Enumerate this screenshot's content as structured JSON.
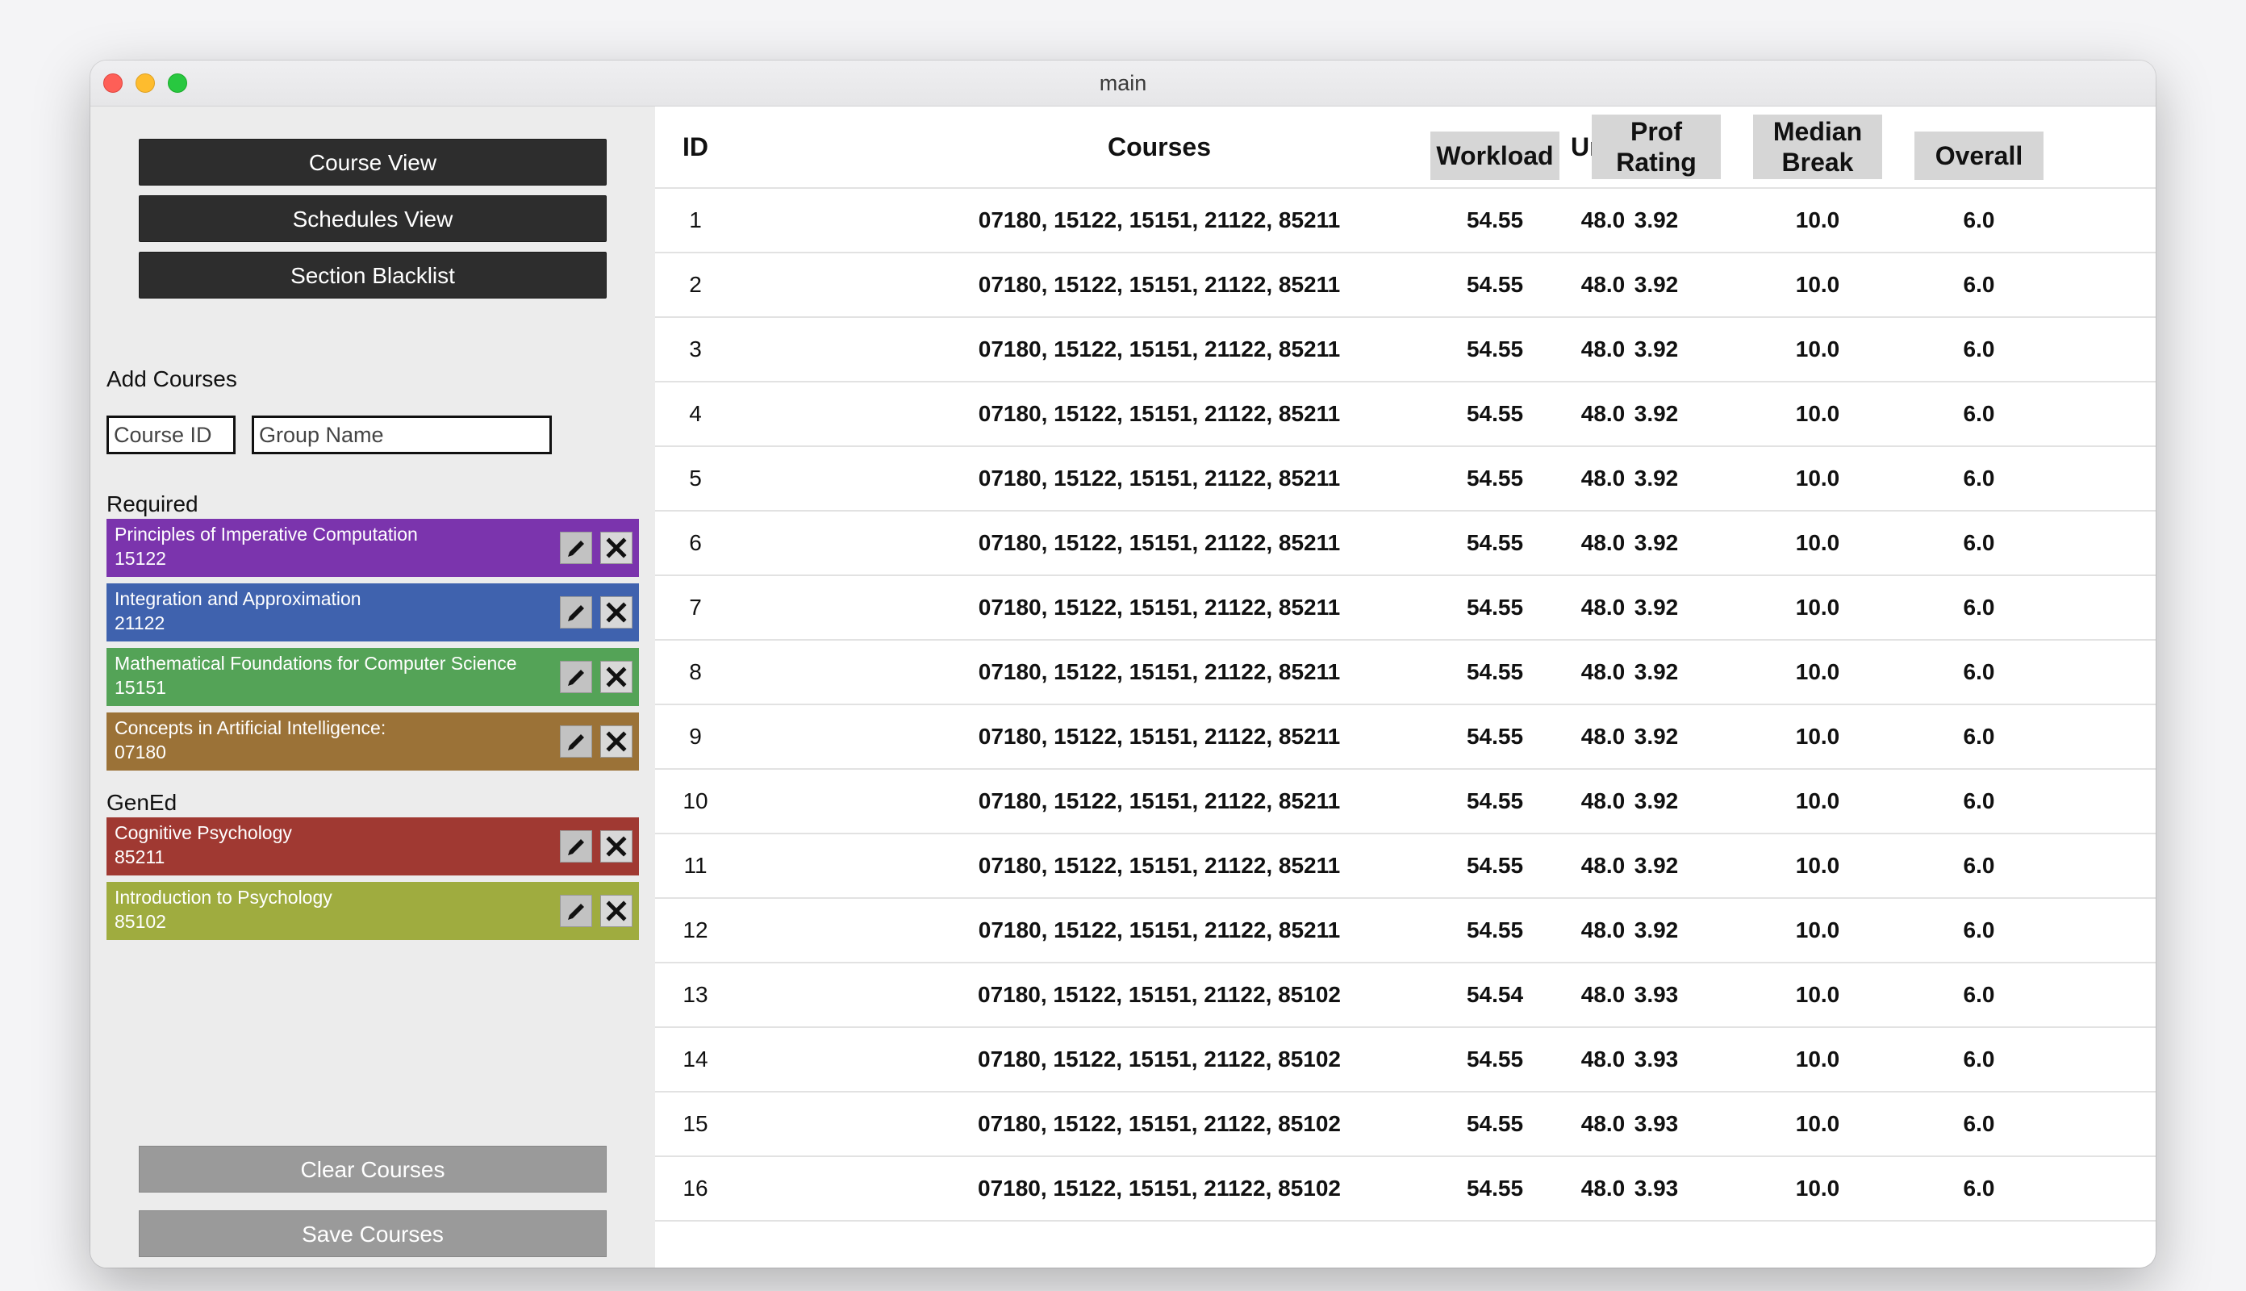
{
  "window": {
    "title": "main"
  },
  "sidebar": {
    "nav_buttons": [
      "Course View",
      "Schedules View",
      "Section Blacklist"
    ],
    "add_courses_label": "Add Courses",
    "course_id_placeholder": "Course ID",
    "group_name_placeholder": "Group Name",
    "groups": [
      {
        "name": "Required",
        "courses": [
          {
            "name": "Principles of Imperative Computation",
            "id": "15122",
            "color": "#7b34ad"
          },
          {
            "name": "Integration and Approximation",
            "id": "21122",
            "color": "#3f62ae"
          },
          {
            "name": "Mathematical Foundations for Computer Science",
            "id": "15151",
            "color": "#54a357"
          },
          {
            "name": "Concepts in Artificial Intelligence:",
            "id": "07180",
            "color": "#9b7237"
          }
        ]
      },
      {
        "name": "GenEd",
        "courses": [
          {
            "name": "Cognitive Psychology",
            "id": "85211",
            "color": "#a03932"
          },
          {
            "name": "Introduction to Psychology",
            "id": "85102",
            "color": "#9fac3f"
          }
        ]
      }
    ],
    "clear_courses_label": "Clear Courses",
    "save_courses_label": "Save Courses"
  },
  "table": {
    "headers": [
      "ID",
      "Courses",
      "Units",
      "Workload",
      "Prof Rating",
      "Median Break",
      "Overall"
    ],
    "rows": [
      [
        "1",
        "07180, 15122, 15151, 21122, 85211",
        "48.0",
        "54.55",
        "3.92",
        "10.0",
        "6.0"
      ],
      [
        "2",
        "07180, 15122, 15151, 21122, 85211",
        "48.0",
        "54.55",
        "3.92",
        "10.0",
        "6.0"
      ],
      [
        "3",
        "07180, 15122, 15151, 21122, 85211",
        "48.0",
        "54.55",
        "3.92",
        "10.0",
        "6.0"
      ],
      [
        "4",
        "07180, 15122, 15151, 21122, 85211",
        "48.0",
        "54.55",
        "3.92",
        "10.0",
        "6.0"
      ],
      [
        "5",
        "07180, 15122, 15151, 21122, 85211",
        "48.0",
        "54.55",
        "3.92",
        "10.0",
        "6.0"
      ],
      [
        "6",
        "07180, 15122, 15151, 21122, 85211",
        "48.0",
        "54.55",
        "3.92",
        "10.0",
        "6.0"
      ],
      [
        "7",
        "07180, 15122, 15151, 21122, 85211",
        "48.0",
        "54.55",
        "3.92",
        "10.0",
        "6.0"
      ],
      [
        "8",
        "07180, 15122, 15151, 21122, 85211",
        "48.0",
        "54.55",
        "3.92",
        "10.0",
        "6.0"
      ],
      [
        "9",
        "07180, 15122, 15151, 21122, 85211",
        "48.0",
        "54.55",
        "3.92",
        "10.0",
        "6.0"
      ],
      [
        "10",
        "07180, 15122, 15151, 21122, 85211",
        "48.0",
        "54.55",
        "3.92",
        "10.0",
        "6.0"
      ],
      [
        "11",
        "07180, 15122, 15151, 21122, 85211",
        "48.0",
        "54.55",
        "3.92",
        "10.0",
        "6.0"
      ],
      [
        "12",
        "07180, 15122, 15151, 21122, 85211",
        "48.0",
        "54.55",
        "3.92",
        "10.0",
        "6.0"
      ],
      [
        "13",
        "07180, 15122, 15151, 21122, 85102",
        "48.0",
        "54.54",
        "3.93",
        "10.0",
        "6.0"
      ],
      [
        "14",
        "07180, 15122, 15151, 21122, 85102",
        "48.0",
        "54.55",
        "3.93",
        "10.0",
        "6.0"
      ],
      [
        "15",
        "07180, 15122, 15151, 21122, 85102",
        "48.0",
        "54.55",
        "3.93",
        "10.0",
        "6.0"
      ],
      [
        "16",
        "07180, 15122, 15151, 21122, 85102",
        "48.0",
        "54.55",
        "3.93",
        "10.0",
        "6.0"
      ]
    ]
  }
}
